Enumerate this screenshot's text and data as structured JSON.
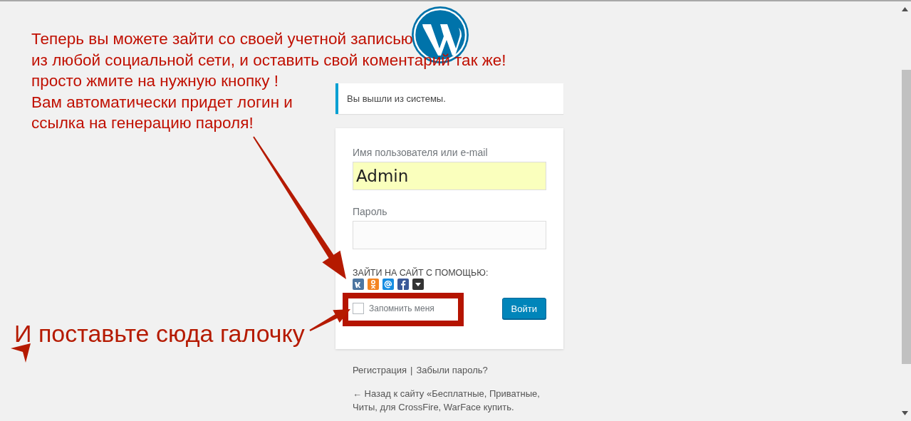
{
  "notice": {
    "text": "Вы вышли из системы."
  },
  "login_form": {
    "username_label": "Имя пользователя или e-mail",
    "username_value": "Admin",
    "password_label": "Пароль",
    "social_label": "ЗАЙТИ НА САЙТ С ПОМОЩЬЮ:",
    "social_buttons": [
      {
        "kind": "vk",
        "color": "#4d76a1"
      },
      {
        "kind": "ok",
        "color": "#f48420"
      },
      {
        "kind": "mail",
        "color": "#168de2"
      },
      {
        "kind": "facebook",
        "color": "#3b5998"
      },
      {
        "kind": "more",
        "color": "#333333"
      }
    ],
    "remember": {
      "label": "Запомнить меня",
      "checked": false
    },
    "submit": "Войти"
  },
  "links": {
    "register": "Регистрация",
    "separator": "|",
    "lost_password": "Забыли пароль?",
    "back": "← Назад к сайту «Бесплатные, Приватные, Читы, для CrossFire, WarFace купить."
  },
  "annotations": {
    "note_lines": [
      "Теперь вы можете зайти со своей учетной записью",
      "из любой социальной сети, и оставить свой коментарий так же!",
      "просто жмите на нужную кнопку !",
      "Вам автоматически придет логин и",
      "ссылка на генерацию пароля!"
    ],
    "big_note": "И поставьте сюда галочку"
  }
}
